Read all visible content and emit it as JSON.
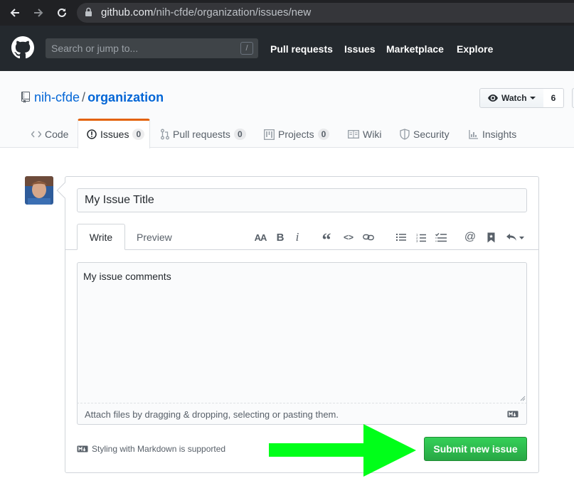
{
  "browser": {
    "url_host": "github.com",
    "url_path": "/nih-cfde/organization/issues/new",
    "icons": [
      "back-arrow-icon",
      "forward-arrow-icon",
      "reload-icon",
      "lock-icon"
    ]
  },
  "header": {
    "search_placeholder": "Search or jump to...",
    "search_shortcut": "/",
    "nav": [
      "Pull requests",
      "Issues",
      "Marketplace",
      "Explore"
    ]
  },
  "repo": {
    "owner": "nih-cfde",
    "separator": "/",
    "name": "organization",
    "watch_label": "Watch",
    "watch_count": "6"
  },
  "tabs": [
    {
      "label": "Code",
      "icon": "code-icon"
    },
    {
      "label": "Issues",
      "count": "0",
      "icon": "issue-icon",
      "selected": true
    },
    {
      "label": "Pull requests",
      "count": "0",
      "icon": "pull-request-icon"
    },
    {
      "label": "Projects",
      "count": "0",
      "icon": "project-icon"
    },
    {
      "label": "Wiki",
      "icon": "book-icon"
    },
    {
      "label": "Security",
      "icon": "shield-icon"
    },
    {
      "label": "Insights",
      "icon": "graph-icon"
    }
  ],
  "form": {
    "title_value": "My Issue Title",
    "write_tab": "Write",
    "preview_tab": "Preview",
    "toolbar": {
      "header": "AA",
      "bold": "B",
      "italic": "i",
      "quote": "“",
      "code": "<>",
      "mention": "@"
    },
    "comment_value": "My issue comments",
    "attach_hint": "Attach files by dragging & dropping, selecting or pasting them.",
    "markdown_note": "Styling with Markdown is supported",
    "submit_label": "Submit new issue"
  },
  "colors": {
    "header_bg": "#24292e",
    "link": "#0366d6",
    "active_tab": "#e36209",
    "submit_green": "#28a745",
    "annotation_arrow": "#00ff19"
  }
}
